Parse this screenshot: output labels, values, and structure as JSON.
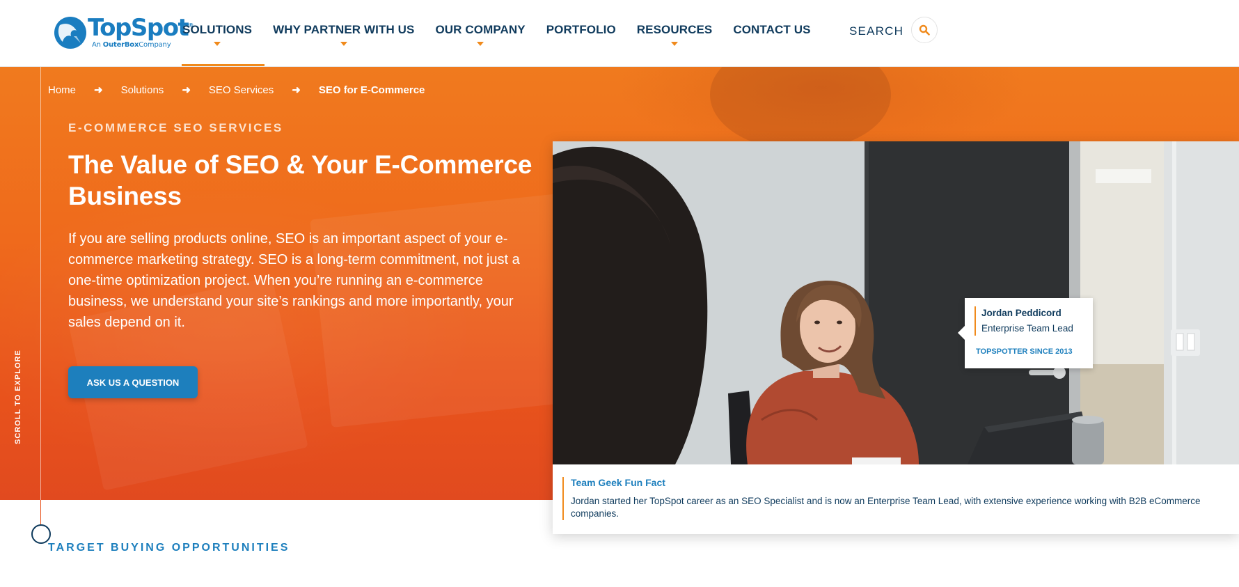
{
  "brand": {
    "logo_name": "TopSpot",
    "logo_tagline_prefix": "An",
    "logo_tagline_brand": "OuterBox",
    "logo_tagline_suffix": "Company",
    "registered_mark": "®",
    "primary_color": "#1d7fbd",
    "accent_color": "#f08a1c",
    "navy_color": "#0e3a5c"
  },
  "nav": {
    "items": [
      {
        "label": "SOLUTIONS",
        "has_dropdown": true,
        "active": true
      },
      {
        "label": "WHY PARTNER WITH US",
        "has_dropdown": true,
        "active": false
      },
      {
        "label": "OUR COMPANY",
        "has_dropdown": true,
        "active": false
      },
      {
        "label": "PORTFOLIO",
        "has_dropdown": false,
        "active": false
      },
      {
        "label": "RESOURCES",
        "has_dropdown": true,
        "active": false
      },
      {
        "label": "CONTACT US",
        "has_dropdown": false,
        "active": false
      }
    ],
    "search_label": "SEARCH",
    "search_icon": "magnifier-icon"
  },
  "breadcrumb": {
    "items": [
      "Home",
      "Solutions",
      "SEO Services",
      "SEO for E-Commerce"
    ],
    "separator": "➜"
  },
  "hero": {
    "eyebrow": "E-COMMERCE SEO SERVICES",
    "title": "The Value of SEO & Your E-Commerce Business",
    "body": "If you are selling products online, SEO is an important aspect of your e-commerce marketing strategy.  SEO is a long-term commitment, not just a one-time optimization project. When you’re running an e-commerce business, we understand your site’s rankings and more importantly, your sales depend on it.",
    "cta_label": "ASK US A QUESTION",
    "background_color": "#ef6a1c"
  },
  "scroll": {
    "label": "SCROLL TO EXPLORE"
  },
  "photo_card": {
    "person_name": "Jordan Peddicord",
    "person_role": "Enterprise Team Lead",
    "person_since": "TOPSPOTTER SINCE 2013",
    "caption_title": "Team Geek Fun Fact",
    "caption_body": "Jordan started her TopSpot career as an SEO Specialist and is now an Enterprise Team Lead, with extensive experience working with B2B eCommerce companies."
  },
  "next_section": {
    "label": "TARGET BUYING OPPORTUNITIES"
  }
}
